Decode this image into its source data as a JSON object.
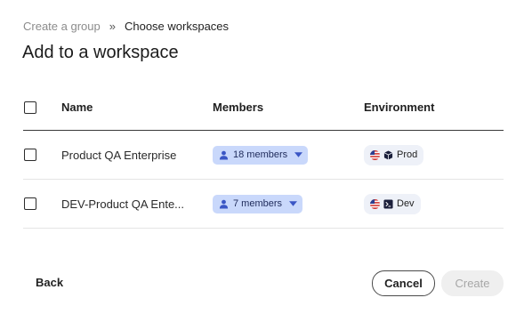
{
  "breadcrumb": {
    "previous": "Create a group",
    "separator": "»",
    "current": "Choose workspaces"
  },
  "title": "Add to a workspace",
  "table": {
    "headers": {
      "name": "Name",
      "members": "Members",
      "environment": "Environment"
    },
    "rows": [
      {
        "name": "Product QA Enterprise",
        "members": "18 members",
        "environment": "Prod",
        "env_icon": "cube-icon",
        "flag": "us-flag-icon"
      },
      {
        "name": "DEV-Product QA Ente...",
        "members": "7 members",
        "environment": "Dev",
        "env_icon": "terminal-icon",
        "flag": "us-flag-icon"
      }
    ]
  },
  "footer": {
    "back": "Back",
    "cancel": "Cancel",
    "create": "Create"
  },
  "colors": {
    "members_pill": "#c9d8fb",
    "env_pill": "#eef1f8",
    "create_disabled_bg": "#efefef"
  }
}
